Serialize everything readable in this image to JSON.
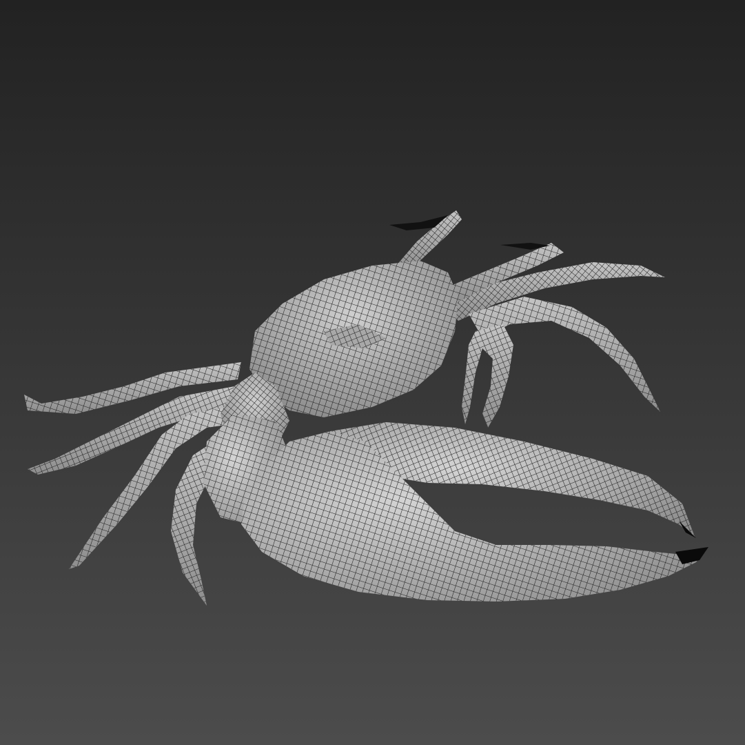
{
  "viewport": {
    "background_top": "#222222",
    "background_bottom": "#4c4c4c",
    "mesh_fill": "#9a9a9a",
    "mesh_fill_light": "#c8c8c8",
    "wire_color": "#1c1c1c",
    "claw_tip_color": "#0a0a0a"
  },
  "model": {
    "name": "fiddler-crab-wireframe-mesh",
    "display_mode": "wireframe-on-shaded"
  }
}
